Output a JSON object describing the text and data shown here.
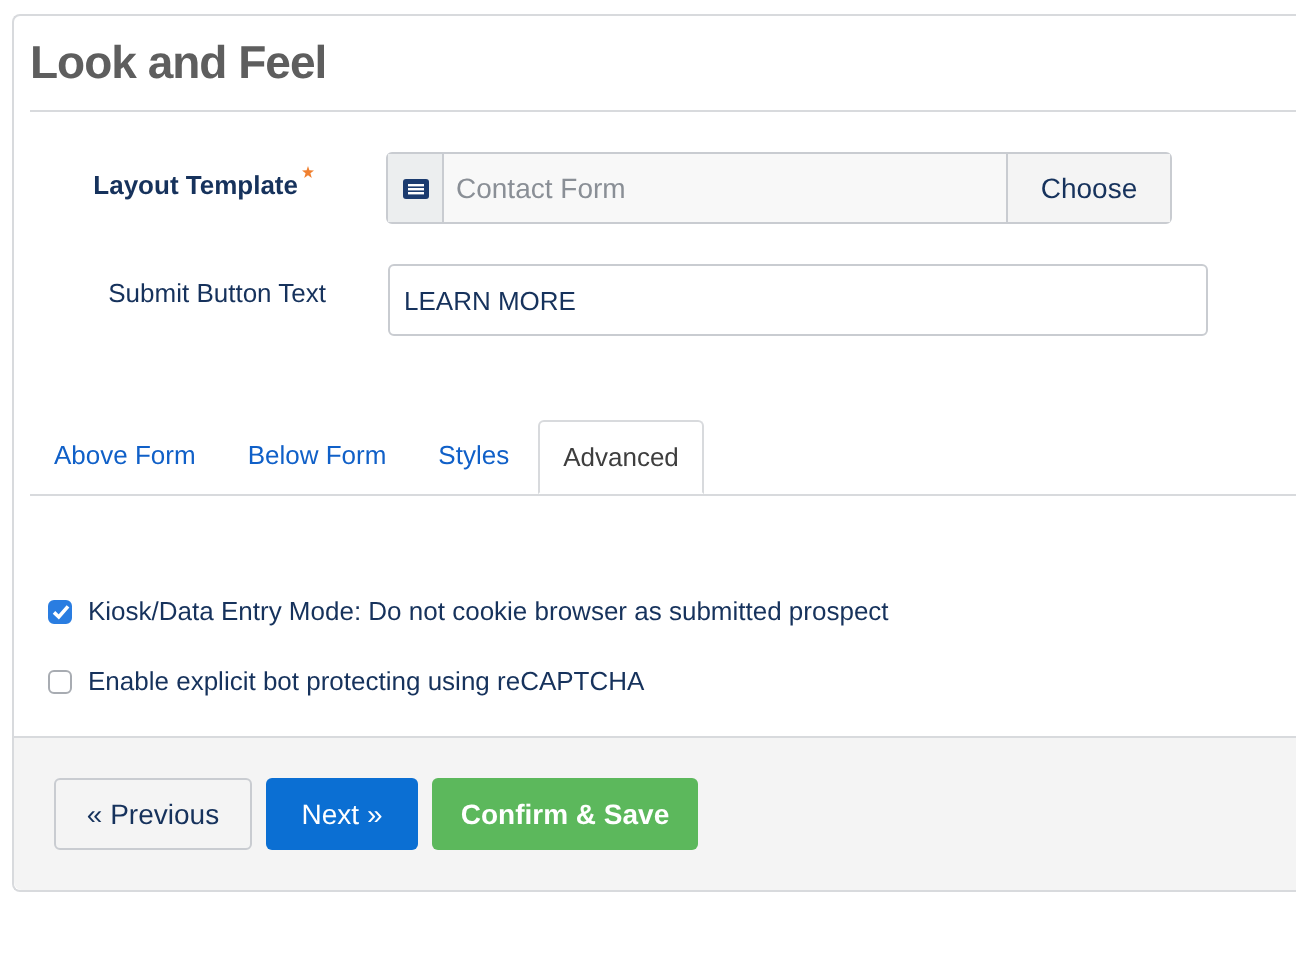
{
  "panel": {
    "title": "Look and Feel"
  },
  "fields": [
    {
      "kind": "chooser",
      "label": "Layout Template",
      "required": true,
      "placeholder": "Contact Form",
      "button": "Choose"
    },
    {
      "kind": "text",
      "label": "Submit Button Text",
      "required": false,
      "value": "LEARN MORE"
    }
  ],
  "tabs": [
    {
      "label": "Above Form",
      "selected": false
    },
    {
      "label": "Below Form",
      "selected": false
    },
    {
      "label": "Styles",
      "selected": false
    },
    {
      "label": "Advanced",
      "selected": true
    }
  ],
  "options": [
    {
      "label": "Kiosk/Data Entry Mode: Do not cookie browser as submitted prospect",
      "checked": true
    },
    {
      "label": "Enable explicit bot protecting using reCAPTCHA",
      "checked": false
    }
  ],
  "buttons": [
    {
      "kind": "default",
      "label": "« Previous"
    },
    {
      "kind": "primary",
      "label": "Next »"
    },
    {
      "kind": "success",
      "label": "Confirm & Save"
    }
  ]
}
